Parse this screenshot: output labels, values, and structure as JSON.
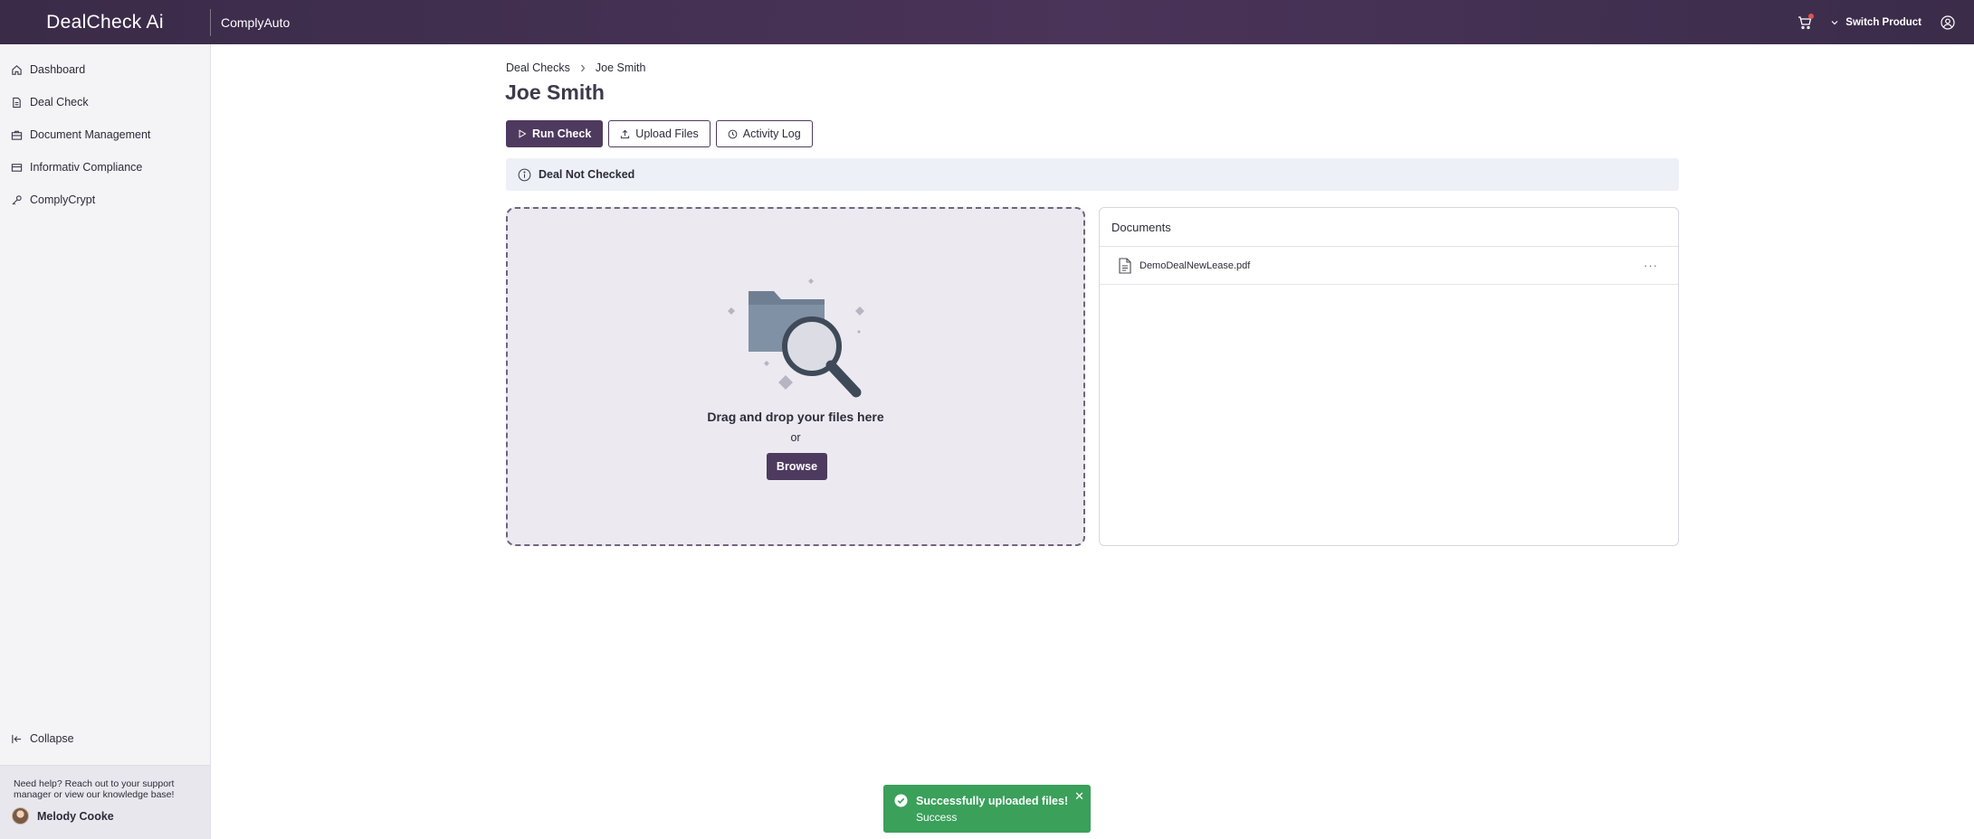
{
  "topbar": {
    "logo_text": "DealCheck Ai",
    "product_name": "ComplyAuto",
    "switch_product_label": "Switch Product"
  },
  "sidebar": {
    "items": [
      {
        "label": "Dashboard",
        "icon": "home-icon"
      },
      {
        "label": "Deal Check",
        "icon": "document-icon"
      },
      {
        "label": "Document Management",
        "icon": "briefcase-icon"
      },
      {
        "label": "Informativ Compliance",
        "icon": "card-icon"
      },
      {
        "label": "ComplyCrypt",
        "icon": "key-icon"
      }
    ],
    "collapse_label": "Collapse",
    "help_text": "Need help? Reach out to your support manager or view our knowledge base!",
    "user_name": "Melody Cooke"
  },
  "breadcrumb": {
    "parent": "Deal Checks",
    "current": "Joe Smith"
  },
  "page": {
    "title": "Joe Smith"
  },
  "actions": {
    "run_check": "Run Check",
    "upload_files": "Upload Files",
    "activity_log": "Activity Log"
  },
  "status_banner": {
    "text": "Deal Not Checked"
  },
  "dropzone": {
    "title": "Drag and drop your files here",
    "or_text": "or",
    "browse_label": "Browse"
  },
  "documents": {
    "header": "Documents",
    "files": [
      {
        "name": "DemoDealNewLease.pdf",
        "icon": "file-icon"
      }
    ]
  },
  "toast": {
    "title": "Successfully uploaded files!",
    "subtitle": "Success",
    "color": "#3aa05a"
  },
  "colors": {
    "brand": "#4e3a5f",
    "topbar": "#3a2b48",
    "success": "#3aa05a"
  }
}
